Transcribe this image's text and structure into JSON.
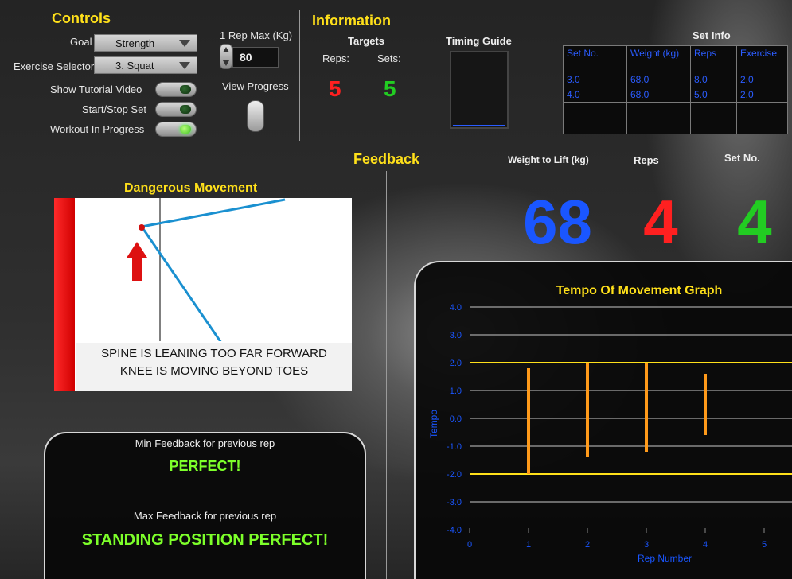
{
  "controls": {
    "title": "Controls",
    "goal_label": "Goal",
    "goal_value": "Strength",
    "exercise_label": "Exercise Selector",
    "exercise_value": "3. Squat",
    "rep_max_label": "1 Rep Max (Kg)",
    "rep_max_value": "80",
    "show_tutorial_label": "Show Tutorial Video",
    "start_stop_label": "Start/Stop Set",
    "workout_label": "Workout In Progress",
    "view_progress_label": "View Progress"
  },
  "information": {
    "title": "Information",
    "targets_label": "Targets",
    "reps_label": "Reps:",
    "sets_label": "Sets:",
    "reps_value": "5",
    "sets_value": "5",
    "timing_guide_label": "Timing Guide"
  },
  "set_info": {
    "title": "Set Info",
    "headers": [
      "Set No.",
      "Weight (kg)",
      "Reps",
      "Exercise"
    ],
    "rows": [
      [
        "3.0",
        "68.0",
        "8.0",
        "2.0"
      ],
      [
        "4.0",
        "68.0",
        "5.0",
        "2.0"
      ],
      [
        "",
        "",
        "",
        ""
      ]
    ]
  },
  "feedback": {
    "title": "Feedback",
    "weight_label": "Weight to Lift (kg)",
    "reps_label": "Reps",
    "set_label": "Set No.",
    "weight_value": "68",
    "reps_value": "4",
    "set_value": "4"
  },
  "danger": {
    "title": "Dangerous Movement",
    "line1": "SPINE IS LEANING TOO FAR FORWARD",
    "line2": "KNEE IS MOVING BEYOND TOES"
  },
  "rep_feedback": {
    "min_label": "Min Feedback for previous rep",
    "min_value": "PERFECT!",
    "max_label": "Max Feedback for previous rep",
    "max_value": "STANDING POSITION PERFECT!"
  },
  "colors": {
    "accent_yellow": "#ffe01a",
    "red": "#ff2020",
    "green": "#22cc22",
    "blue": "#1a56ff",
    "orange": "#ff9a1a",
    "feedback_green": "#7dff2a"
  },
  "chart_data": {
    "type": "bar",
    "title": "Tempo Of Movement Graph",
    "xlabel": "Rep Number",
    "ylabel": "Tempo",
    "ylim": [
      -4.0,
      4.0
    ],
    "xlim": [
      0,
      5
    ],
    "yticks": [
      "4.0",
      "3.0",
      "2.0",
      "1.0",
      "0.0",
      "-1.0",
      "-2.0",
      "-3.0",
      "-4.0"
    ],
    "xticks": [
      "0",
      "1",
      "2",
      "3",
      "4",
      "5"
    ],
    "limit_lines": [
      2.0,
      -2.0
    ],
    "grid": true,
    "series": [
      {
        "x": [
          1,
          2,
          3,
          4
        ],
        "low": [
          -2.0,
          -1.4,
          -1.2,
          -0.6
        ],
        "high": [
          1.8,
          2.0,
          2.0,
          1.6
        ]
      }
    ]
  }
}
